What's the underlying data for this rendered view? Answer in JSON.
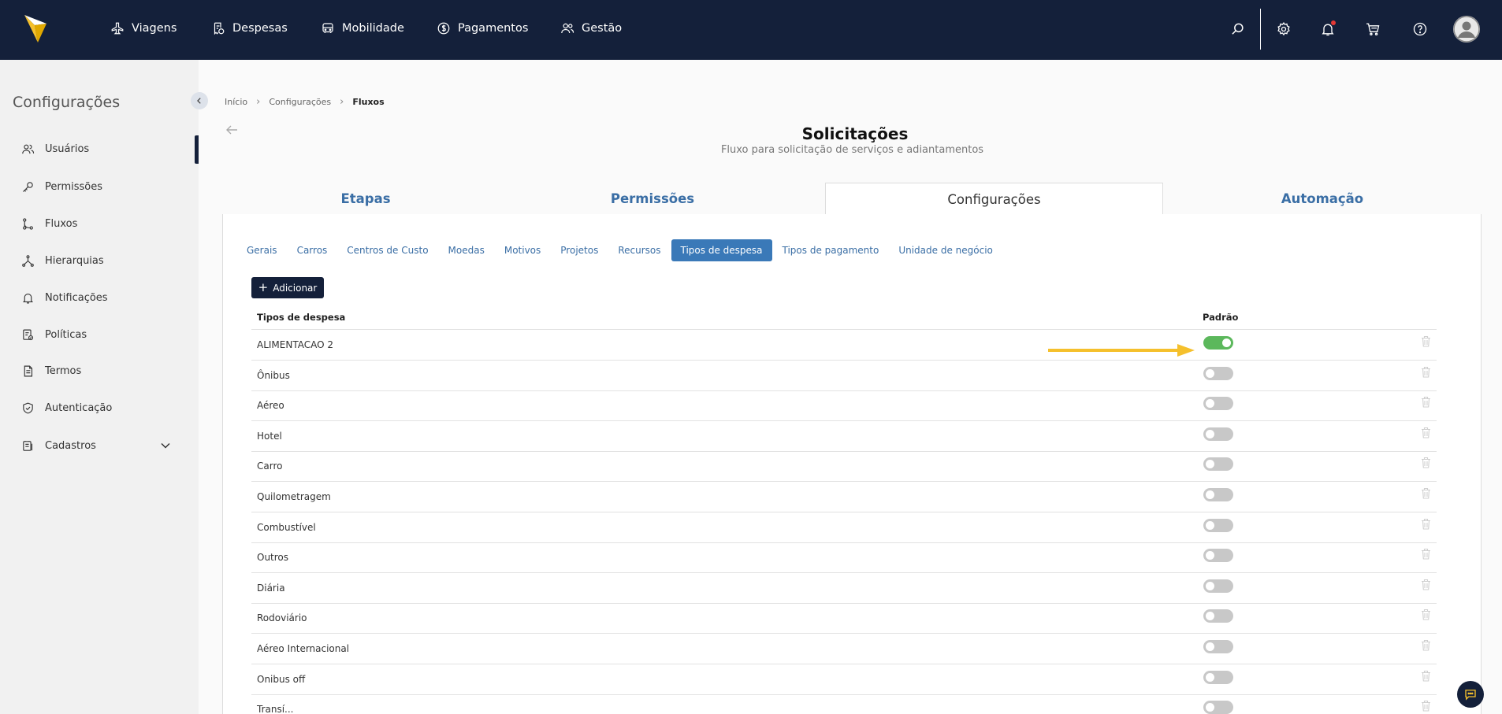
{
  "nav": {
    "items": [
      {
        "label": "Viagens",
        "icon": "plane-icon"
      },
      {
        "label": "Despesas",
        "icon": "receipt-icon"
      },
      {
        "label": "Mobilidade",
        "icon": "car-icon"
      },
      {
        "label": "Pagamentos",
        "icon": "dollar-icon"
      },
      {
        "label": "Gestão",
        "icon": "users-icon"
      }
    ],
    "right_icons": [
      "search-icon",
      "gear-icon",
      "bell-icon",
      "cart-icon",
      "help-icon",
      "avatar-icon"
    ]
  },
  "sidebar": {
    "title": "Configurações",
    "items": [
      {
        "label": "Usuários",
        "icon": "users-icon"
      },
      {
        "label": "Permissões",
        "icon": "key-icon"
      },
      {
        "label": "Fluxos",
        "icon": "flow-icon"
      },
      {
        "label": "Hierarquias",
        "icon": "hierarchy-icon"
      },
      {
        "label": "Notificações",
        "icon": "bell-icon"
      },
      {
        "label": "Políticas",
        "icon": "policy-icon"
      },
      {
        "label": "Termos",
        "icon": "document-icon"
      },
      {
        "label": "Autenticação",
        "icon": "shield-icon"
      },
      {
        "label": "Cadastros",
        "icon": "folder-icon"
      }
    ],
    "active_item": "Fluxos"
  },
  "breadcrumb": {
    "items": [
      "Início",
      "Configurações",
      "Fluxos"
    ]
  },
  "page": {
    "title": "Solicitações",
    "subtitle": "Fluxo para solicitação de serviços e adiantamentos"
  },
  "main_tabs": {
    "items": [
      "Etapas",
      "Permissões",
      "Configurações",
      "Automação"
    ],
    "active": "Configurações"
  },
  "sub_tabs": {
    "items": [
      "Gerais",
      "Carros",
      "Centros de Custo",
      "Moedas",
      "Motivos",
      "Projetos",
      "Recursos",
      "Tipos de despesa",
      "Tipos de pagamento",
      "Unidade de negócio"
    ],
    "active": "Tipos de despesa"
  },
  "add_button": {
    "label": "Adicionar"
  },
  "table": {
    "headers": {
      "name": "Tipos de despesa",
      "default": "Padrão"
    },
    "rows": [
      {
        "name": "ALIMENTACAO 2",
        "default": true
      },
      {
        "name": "Ônibus",
        "default": false
      },
      {
        "name": "Aéreo",
        "default": false
      },
      {
        "name": "Hotel",
        "default": false
      },
      {
        "name": "Carro",
        "default": false
      },
      {
        "name": "Quilometragem",
        "default": false
      },
      {
        "name": "Combustível",
        "default": false
      },
      {
        "name": "Outros",
        "default": false
      },
      {
        "name": "Diária",
        "default": false
      },
      {
        "name": "Rodoviário",
        "default": false
      },
      {
        "name": "Aéreo Internacional",
        "default": false
      },
      {
        "name": "Onibus off",
        "default": false
      },
      {
        "name": "Transí...",
        "default": false
      }
    ]
  },
  "colors": {
    "topbar": "#14203a",
    "accent": "#3a79b8",
    "toggle_on": "#5cb85c",
    "annotation": "#f5c02c",
    "logo": "#f5c02c"
  }
}
